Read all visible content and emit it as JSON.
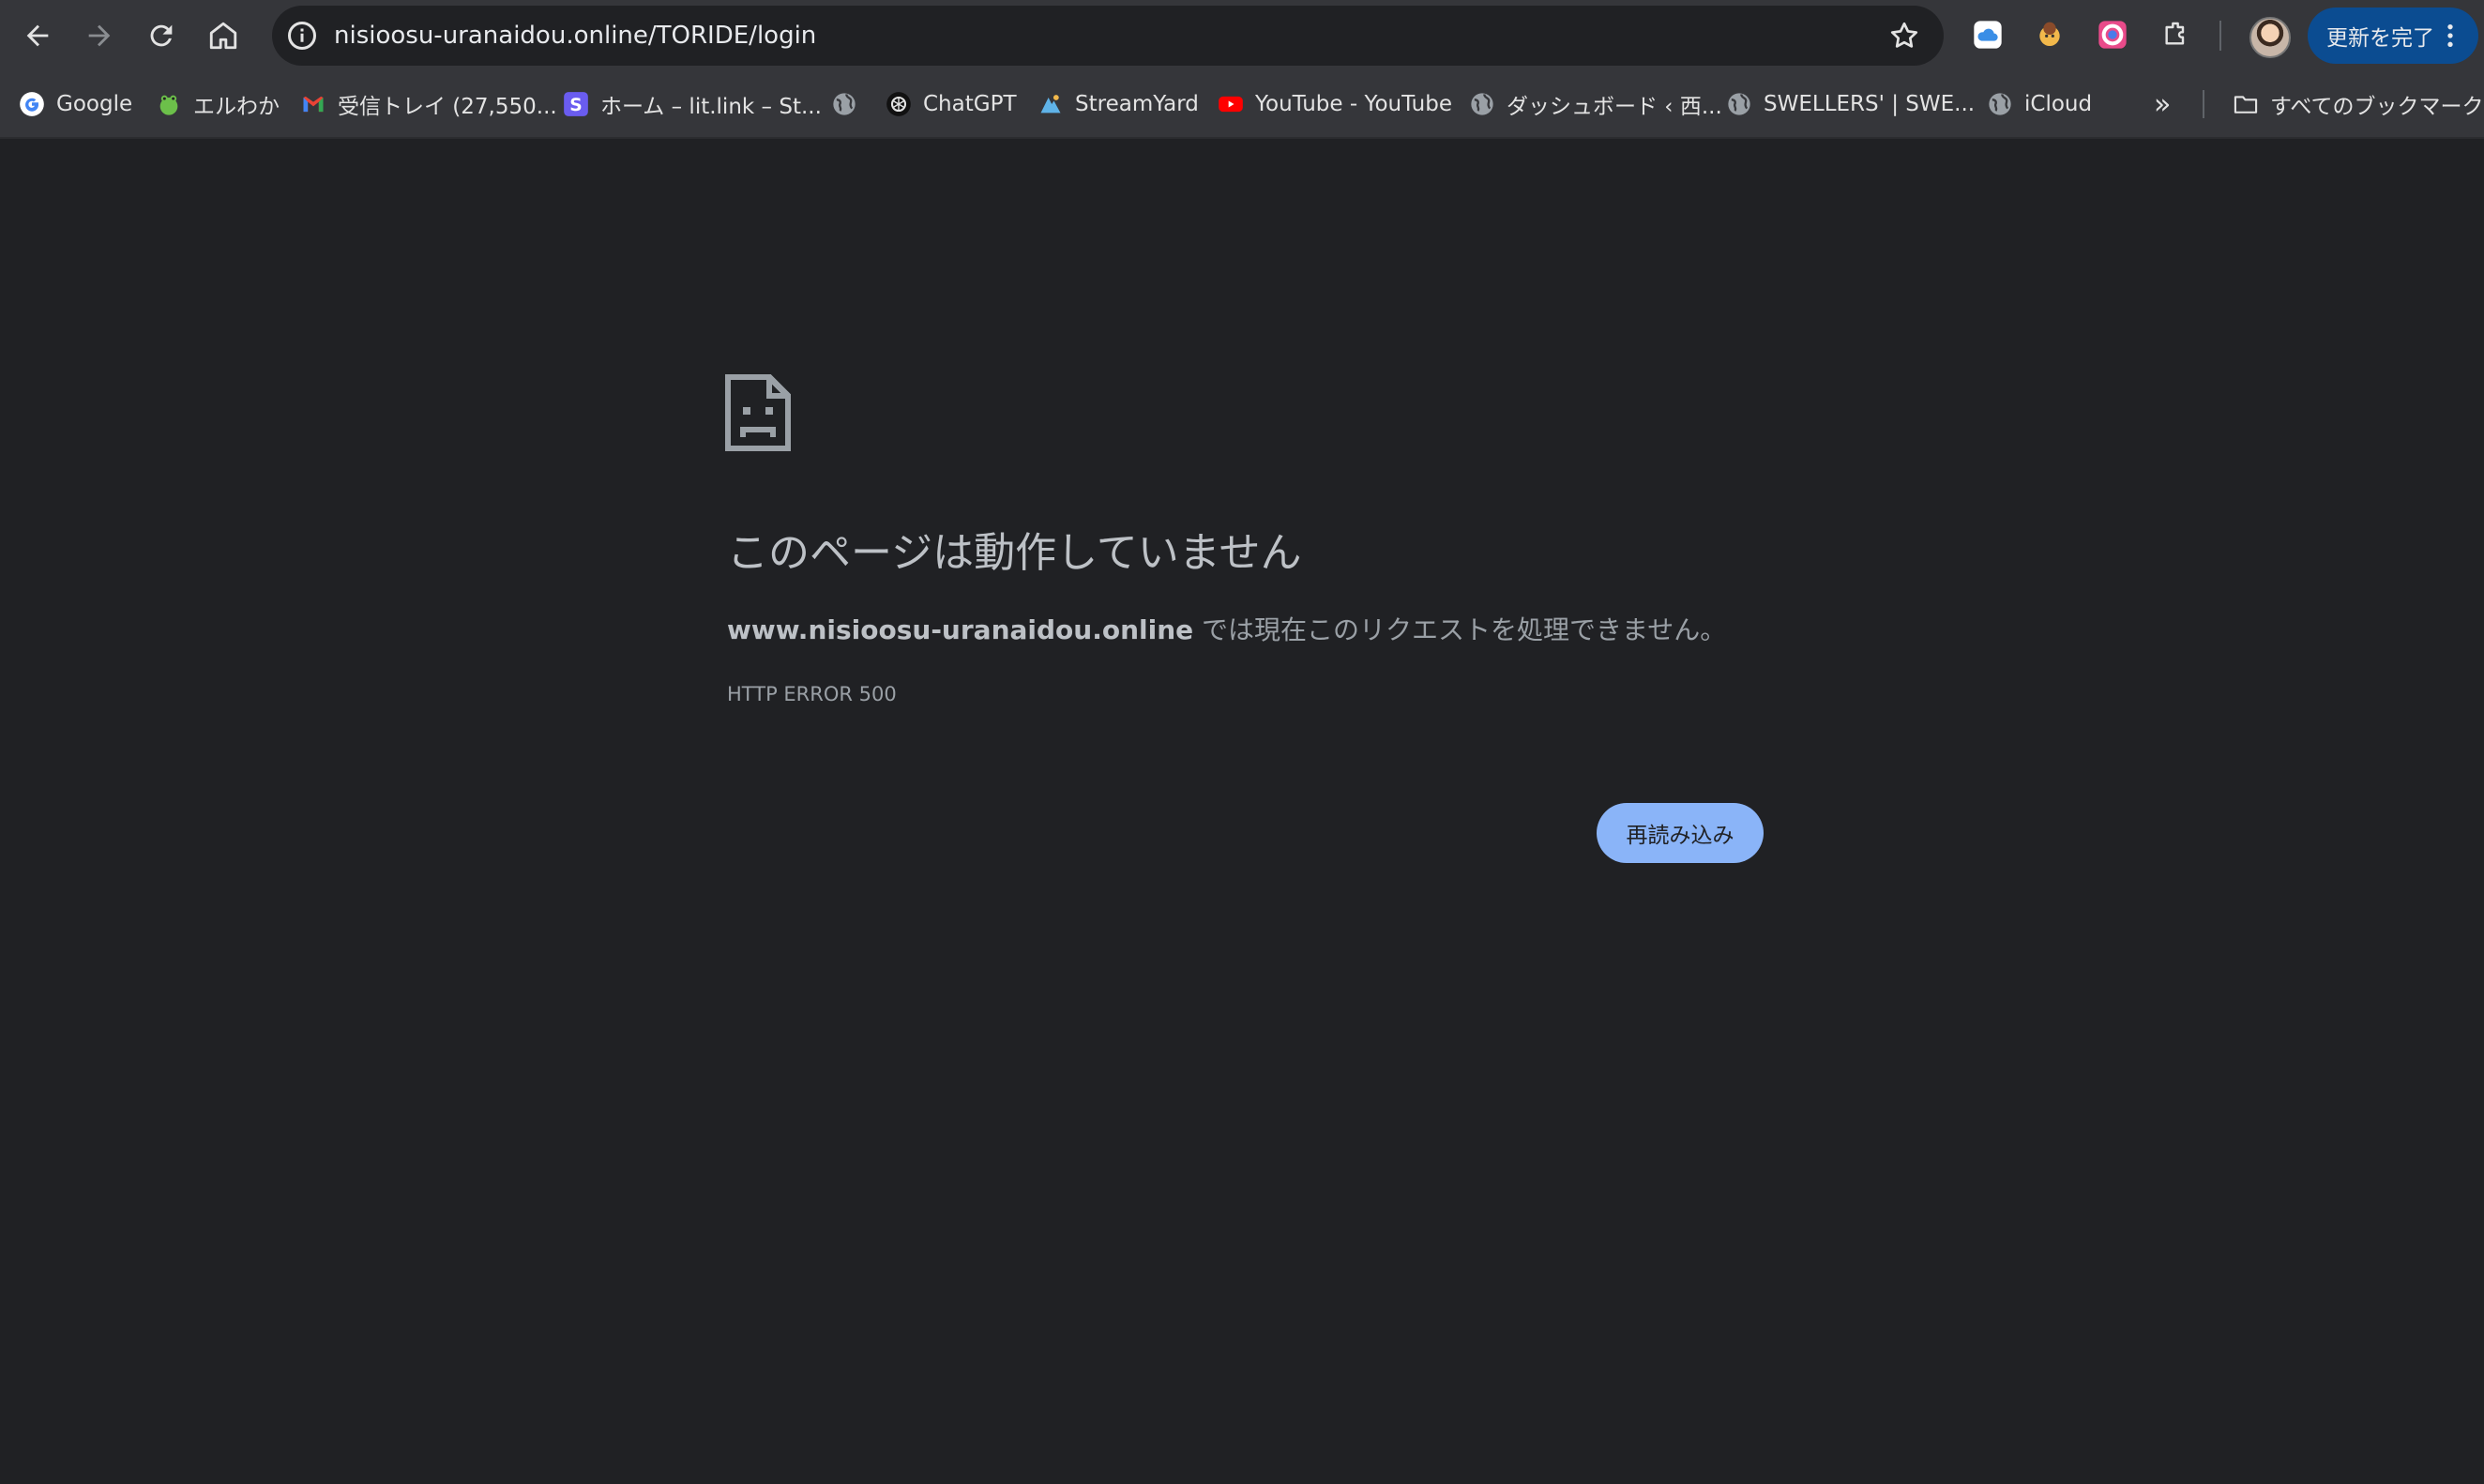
{
  "toolbar": {
    "url": "nisioosu-uranaidou.online/TORIDE/login",
    "update_label": "更新を完了"
  },
  "bookmarks": {
    "items": [
      {
        "label": "Google"
      },
      {
        "label": "エルわか"
      },
      {
        "label": "受信トレイ (27,550..."
      },
      {
        "label": "ホーム – lit.link – St..."
      },
      {
        "label": ""
      },
      {
        "label": "ChatGPT"
      },
      {
        "label": "StreamYard"
      },
      {
        "label": "YouTube - YouTube"
      },
      {
        "label": "ダッシュボード ‹ 西..."
      },
      {
        "label": "SWELLERS' | SWE..."
      },
      {
        "label": "iCloud"
      }
    ],
    "overflow": "»",
    "all_bookmarks": "すべてのブックマーク"
  },
  "error": {
    "title": "このページは動作していません",
    "host": "www.nisioosu-uranaidou.online",
    "message": " では現在このリクエストを処理できません。",
    "code": "HTTP ERROR 500",
    "reload_label": "再読み込み"
  },
  "colors": {
    "background": "#202124",
    "toolbar": "#35363a",
    "accent": "#8ab4f8",
    "update_button": "#0b4c91"
  }
}
